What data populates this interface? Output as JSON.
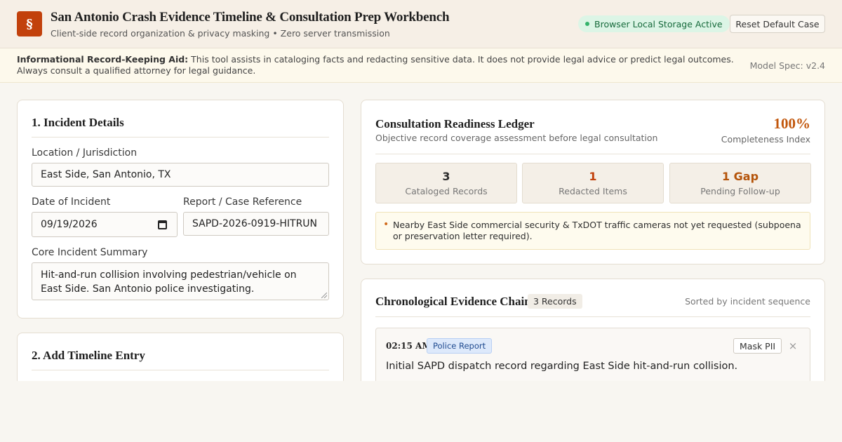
{
  "header": {
    "logo_glyph": "§",
    "title": "San Antonio Crash Evidence Timeline & Consultation Prep Workbench",
    "subtitle": "Client-side record organization & privacy masking • Zero server transmission",
    "storage_status": "Browser Local Storage Active",
    "reset_label": "Reset Default Case"
  },
  "disclaimer": {
    "lead": "Informational Record-Keeping Aid:",
    "text": "This tool assists in cataloging facts and redacting sensitive data. It does not provide legal advice or predict legal outcomes. Always consult a qualified attorney for legal guidance.",
    "model_spec": "Model Spec: v2.4"
  },
  "incident": {
    "section_title": "1. Incident Details",
    "location_label": "Location / Jurisdiction",
    "location_value": "East Side, San Antonio, TX",
    "date_label": "Date of Incident",
    "date_value": "09/19/2026",
    "reference_label": "Report / Case Reference",
    "reference_value": "SAPD-2026-0919-HITRUN",
    "summary_label": "Core Incident Summary",
    "summary_value": "Hit-and-run collision involving pedestrian/vehicle on East Side. San Antonio police investigating."
  },
  "timeline_form": {
    "section_title": "2. Add Timeline Entry"
  },
  "ledger": {
    "title": "Consultation Readiness Ledger",
    "subtitle": "Objective record coverage assessment before legal consultation",
    "completeness_value": "100%",
    "completeness_label": "Completeness Index",
    "stats": [
      {
        "value": "3",
        "label": "Cataloged Records",
        "color": "#2b2b2b"
      },
      {
        "value": "1",
        "label": "Redacted Items",
        "color": "#c2410c"
      },
      {
        "value": "1 Gap",
        "label": "Pending Follow-up",
        "color": "#b45309"
      }
    ],
    "gap_note": "Nearby East Side commercial security & TxDOT traffic cameras not yet requested (subpoena or preservation letter required)."
  },
  "evidence_chain": {
    "title": "Chronological Evidence Chain",
    "count_badge": "3 Records",
    "sort_note": "Sorted by incident sequence",
    "entries": [
      {
        "time": "02:15 AM",
        "type": "Police Report",
        "mask_label": "Mask PII",
        "close_glyph": "×",
        "description": "Initial SAPD dispatch record regarding East Side hit-and-run collision."
      }
    ]
  },
  "colors": {
    "accent": "#c2410c",
    "success": "#166a3b",
    "info": "#1f4a8f"
  }
}
